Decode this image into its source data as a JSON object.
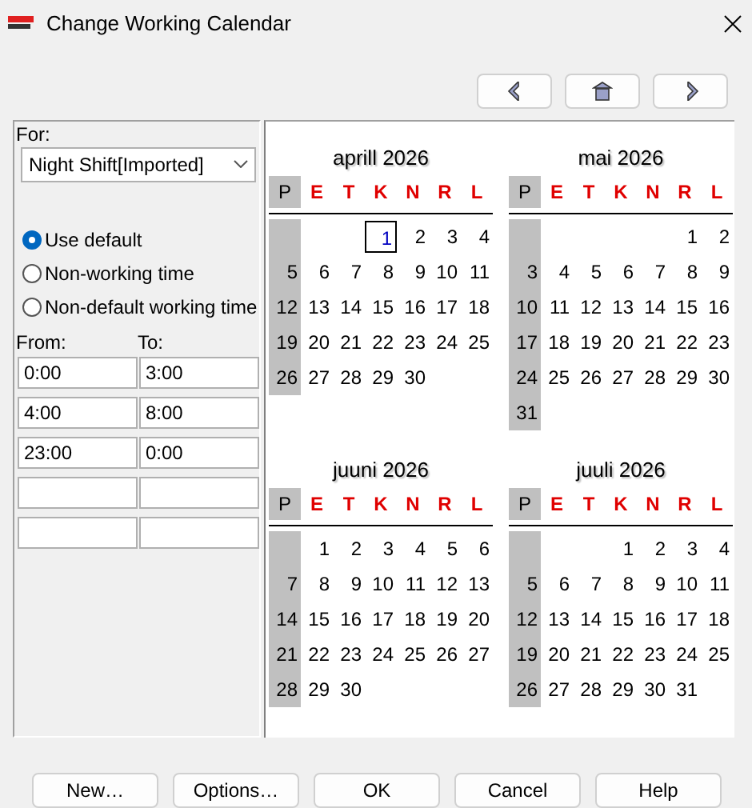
{
  "window": {
    "title": "Change Working Calendar"
  },
  "nav_buttons": [
    {
      "kind": "prev"
    },
    {
      "kind": "home"
    },
    {
      "kind": "next"
    }
  ],
  "for": {
    "label": "For:",
    "value": "Night Shift[Imported]"
  },
  "options": [
    {
      "label": "Use default",
      "selected": true
    },
    {
      "label": "Non-working time",
      "selected": false
    },
    {
      "label": "Non-default working time",
      "selected": false
    }
  ],
  "time_headers": {
    "from": "From:",
    "to": "To:"
  },
  "time_rows": [
    {
      "from": "0:00",
      "to": "3:00"
    },
    {
      "from": "4:00",
      "to": "8:00"
    },
    {
      "from": "23:00",
      "to": "0:00"
    },
    {},
    {}
  ],
  "months": [
    {
      "title": "aprill 2026",
      "weekdays": [
        {
          "label": "P",
          "kind": "rest"
        },
        {
          "label": "E",
          "kind": "work"
        },
        {
          "label": "T",
          "kind": "work"
        },
        {
          "label": "K",
          "kind": "work"
        },
        {
          "label": "N",
          "kind": "work"
        },
        {
          "label": "R",
          "kind": "work"
        },
        {
          "label": "L",
          "kind": "work"
        }
      ],
      "weeks": [
        [
          {
            "d": "1",
            "selected": true
          },
          {
            "d": "2",
            "selected": false
          },
          {
            "d": "3",
            "selected": false
          },
          {
            "d": "4",
            "selected": false
          }
        ],
        [
          {
            "d": "5",
            "selected": false
          },
          {
            "d": "6",
            "selected": false
          },
          {
            "d": "7",
            "selected": false
          },
          {
            "d": "8",
            "selected": false
          },
          {
            "d": "9",
            "selected": false
          },
          {
            "d": "10",
            "selected": false
          },
          {
            "d": "11",
            "selected": false
          }
        ],
        [
          {
            "d": "12",
            "selected": false
          },
          {
            "d": "13",
            "selected": false
          },
          {
            "d": "14",
            "selected": false
          },
          {
            "d": "15",
            "selected": false
          },
          {
            "d": "16",
            "selected": false
          },
          {
            "d": "17",
            "selected": false
          },
          {
            "d": "18",
            "selected": false
          }
        ],
        [
          {
            "d": "19",
            "selected": false
          },
          {
            "d": "20",
            "selected": false
          },
          {
            "d": "21",
            "selected": false
          },
          {
            "d": "22",
            "selected": false
          },
          {
            "d": "23",
            "selected": false
          },
          {
            "d": "24",
            "selected": false
          },
          {
            "d": "25",
            "selected": false
          }
        ],
        [
          {
            "d": "26",
            "selected": false
          },
          {
            "d": "27",
            "selected": false
          },
          {
            "d": "28",
            "selected": false
          },
          {
            "d": "29",
            "selected": false
          },
          {
            "d": "30",
            "selected": false
          }
        ]
      ]
    },
    {
      "title": "mai 2026",
      "weekdays": [
        {
          "label": "P",
          "kind": "rest"
        },
        {
          "label": "E",
          "kind": "work"
        },
        {
          "label": "T",
          "kind": "work"
        },
        {
          "label": "K",
          "kind": "work"
        },
        {
          "label": "N",
          "kind": "work"
        },
        {
          "label": "R",
          "kind": "work"
        },
        {
          "label": "L",
          "kind": "work"
        }
      ],
      "weeks": [
        [
          {
            "d": "1",
            "selected": false
          },
          {
            "d": "2",
            "selected": false
          }
        ],
        [
          {
            "d": "3",
            "selected": false
          },
          {
            "d": "4",
            "selected": false
          },
          {
            "d": "5",
            "selected": false
          },
          {
            "d": "6",
            "selected": false
          },
          {
            "d": "7",
            "selected": false
          },
          {
            "d": "8",
            "selected": false
          },
          {
            "d": "9",
            "selected": false
          }
        ],
        [
          {
            "d": "10",
            "selected": false
          },
          {
            "d": "11",
            "selected": false
          },
          {
            "d": "12",
            "selected": false
          },
          {
            "d": "13",
            "selected": false
          },
          {
            "d": "14",
            "selected": false
          },
          {
            "d": "15",
            "selected": false
          },
          {
            "d": "16",
            "selected": false
          }
        ],
        [
          {
            "d": "17",
            "selected": false
          },
          {
            "d": "18",
            "selected": false
          },
          {
            "d": "19",
            "selected": false
          },
          {
            "d": "20",
            "selected": false
          },
          {
            "d": "21",
            "selected": false
          },
          {
            "d": "22",
            "selected": false
          },
          {
            "d": "23",
            "selected": false
          }
        ],
        [
          {
            "d": "24",
            "selected": false
          },
          {
            "d": "25",
            "selected": false
          },
          {
            "d": "26",
            "selected": false
          },
          {
            "d": "27",
            "selected": false
          },
          {
            "d": "28",
            "selected": false
          },
          {
            "d": "29",
            "selected": false
          },
          {
            "d": "30",
            "selected": false
          }
        ],
        [
          {
            "d": "31",
            "selected": false
          }
        ]
      ]
    },
    {
      "title": "juuni 2026",
      "weekdays": [
        {
          "label": "P",
          "kind": "rest"
        },
        {
          "label": "E",
          "kind": "work"
        },
        {
          "label": "T",
          "kind": "work"
        },
        {
          "label": "K",
          "kind": "work"
        },
        {
          "label": "N",
          "kind": "work"
        },
        {
          "label": "R",
          "kind": "work"
        },
        {
          "label": "L",
          "kind": "work"
        }
      ],
      "weeks": [
        [
          {
            "d": "1",
            "selected": false
          },
          {
            "d": "2",
            "selected": false
          },
          {
            "d": "3",
            "selected": false
          },
          {
            "d": "4",
            "selected": false
          },
          {
            "d": "5",
            "selected": false
          },
          {
            "d": "6",
            "selected": false
          }
        ],
        [
          {
            "d": "7",
            "selected": false
          },
          {
            "d": "8",
            "selected": false
          },
          {
            "d": "9",
            "selected": false
          },
          {
            "d": "10",
            "selected": false
          },
          {
            "d": "11",
            "selected": false
          },
          {
            "d": "12",
            "selected": false
          },
          {
            "d": "13",
            "selected": false
          }
        ],
        [
          {
            "d": "14",
            "selected": false
          },
          {
            "d": "15",
            "selected": false
          },
          {
            "d": "16",
            "selected": false
          },
          {
            "d": "17",
            "selected": false
          },
          {
            "d": "18",
            "selected": false
          },
          {
            "d": "19",
            "selected": false
          },
          {
            "d": "20",
            "selected": false
          }
        ],
        [
          {
            "d": "21",
            "selected": false
          },
          {
            "d": "22",
            "selected": false
          },
          {
            "d": "23",
            "selected": false
          },
          {
            "d": "24",
            "selected": false
          },
          {
            "d": "25",
            "selected": false
          },
          {
            "d": "26",
            "selected": false
          },
          {
            "d": "27",
            "selected": false
          }
        ],
        [
          {
            "d": "28",
            "selected": false
          },
          {
            "d": "29",
            "selected": false
          },
          {
            "d": "30",
            "selected": false
          }
        ]
      ]
    },
    {
      "title": "juuli 2026",
      "weekdays": [
        {
          "label": "P",
          "kind": "rest"
        },
        {
          "label": "E",
          "kind": "work"
        },
        {
          "label": "T",
          "kind": "work"
        },
        {
          "label": "K",
          "kind": "work"
        },
        {
          "label": "N",
          "kind": "work"
        },
        {
          "label": "R",
          "kind": "work"
        },
        {
          "label": "L",
          "kind": "work"
        }
      ],
      "weeks": [
        [
          {
            "d": "1",
            "selected": false
          },
          {
            "d": "2",
            "selected": false
          },
          {
            "d": "3",
            "selected": false
          },
          {
            "d": "4",
            "selected": false
          }
        ],
        [
          {
            "d": "5",
            "selected": false
          },
          {
            "d": "6",
            "selected": false
          },
          {
            "d": "7",
            "selected": false
          },
          {
            "d": "8",
            "selected": false
          },
          {
            "d": "9",
            "selected": false
          },
          {
            "d": "10",
            "selected": false
          },
          {
            "d": "11",
            "selected": false
          }
        ],
        [
          {
            "d": "12",
            "selected": false
          },
          {
            "d": "13",
            "selected": false
          },
          {
            "d": "14",
            "selected": false
          },
          {
            "d": "15",
            "selected": false
          },
          {
            "d": "16",
            "selected": false
          },
          {
            "d": "17",
            "selected": false
          },
          {
            "d": "18",
            "selected": false
          }
        ],
        [
          {
            "d": "19",
            "selected": false
          },
          {
            "d": "20",
            "selected": false
          },
          {
            "d": "21",
            "selected": false
          },
          {
            "d": "22",
            "selected": false
          },
          {
            "d": "23",
            "selected": false
          },
          {
            "d": "24",
            "selected": false
          },
          {
            "d": "25",
            "selected": false
          }
        ],
        [
          {
            "d": "26",
            "selected": false
          },
          {
            "d": "27",
            "selected": false
          },
          {
            "d": "28",
            "selected": false
          },
          {
            "d": "29",
            "selected": false
          },
          {
            "d": "30",
            "selected": false
          },
          {
            "d": "31",
            "selected": false
          }
        ]
      ]
    }
  ],
  "buttons": [
    "New…",
    "Options…",
    "OK",
    "Cancel",
    "Help"
  ]
}
